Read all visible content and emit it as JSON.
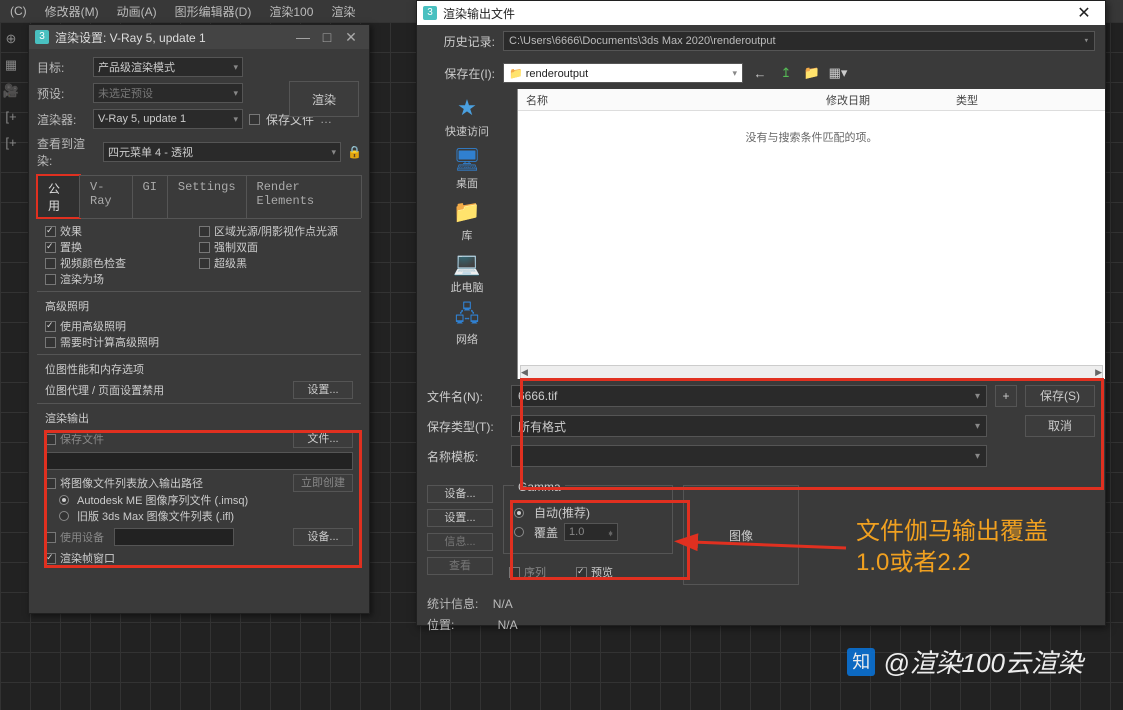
{
  "topmenu": [
    "(C)",
    "修改器(M)",
    "动画(A)",
    "图形编辑器(D)",
    "渲染100",
    "渲染"
  ],
  "rs": {
    "title": "渲染设置: V-Ray 5, update 1",
    "target_lbl": "目标:",
    "target_val": "产品级渲染模式",
    "preset_lbl": "预设:",
    "preset_val": "未选定预设",
    "renderer_lbl": "渲染器:",
    "renderer_val": "V-Ray 5, update 1",
    "savefile_ck": "保存文件",
    "view_lbl": "查看到渲染:",
    "view_val": "四元菜单 4 - 透视",
    "render_btn": "渲染",
    "tabs": [
      "公用",
      "V-Ray",
      "GI",
      "Settings",
      "Render Elements"
    ],
    "opts_col1": [
      {
        "c": true,
        "t": "效果"
      },
      {
        "c": true,
        "t": "置换"
      },
      {
        "c": false,
        "t": "视频颜色检查"
      },
      {
        "c": false,
        "t": "渲染为场"
      }
    ],
    "opts_col2": [
      {
        "c": false,
        "t": "区域光源/阴影视作点光源"
      },
      {
        "c": false,
        "t": "强制双面"
      },
      {
        "c": false,
        "t": "超级黑"
      }
    ],
    "adv_hdr": "高级照明",
    "adv1": {
      "c": true,
      "t": "使用高级照明"
    },
    "adv2": {
      "c": false,
      "t": "需要时计算高级照明"
    },
    "bmp_hdr": "位图性能和内存选项",
    "bmp_line": "位图代理 / 页面设置禁用",
    "setup_btn": "设置...",
    "out_hdr": "渲染输出",
    "out_save": "保存文件",
    "file_btn": "文件...",
    "seq_ck": "将图像文件列表放入输出路径",
    "seq_now": "立即创建",
    "seq_r1": "Autodesk ME 图像序列文件 (.imsq)",
    "seq_r2": "旧版 3ds Max 图像文件列表 (.ifl)",
    "usedev": "使用设备",
    "dev_btn": "设备...",
    "framewin": {
      "c": true,
      "t": "渲染帧窗口"
    }
  },
  "fd": {
    "title": "渲染输出文件",
    "hist_lbl": "历史记录:",
    "hist_val": "C:\\Users\\6666\\Documents\\3ds Max 2020\\renderoutput",
    "savein_lbl": "保存在(I):",
    "savein_val": "renderoutput",
    "places": [
      "快速访问",
      "桌面",
      "库",
      "此电脑",
      "网络"
    ],
    "cols": [
      "名称",
      "修改日期",
      "类型"
    ],
    "empty": "没有与搜索条件匹配的项。",
    "fname_lbl": "文件名(N):",
    "fname_val": "6666.tif",
    "ftype_lbl": "保存类型(T):",
    "ftype_val": "所有格式",
    "tpl_lbl": "名称模板:",
    "save_btn": "保存(S)",
    "cancel_btn": "取消",
    "sidebtns": [
      "设备...",
      "设置...",
      "信息...",
      "查看"
    ],
    "gamma_hdr": "Gamma",
    "gamma_auto": "自动(推荐)",
    "gamma_over": "覆盖",
    "gamma_val": "1.0",
    "seq_ck": "序列",
    "prev_ck": "预览",
    "imgbox": "图像",
    "stat1_l": "统计信息:",
    "stat1_v": "N/A",
    "stat2_l": "位置:",
    "stat2_v": "N/A"
  },
  "anno": {
    "line1": "文件伽马输出覆盖",
    "line2": "1.0或者2.2"
  },
  "wm": "@渲染100云渲染"
}
